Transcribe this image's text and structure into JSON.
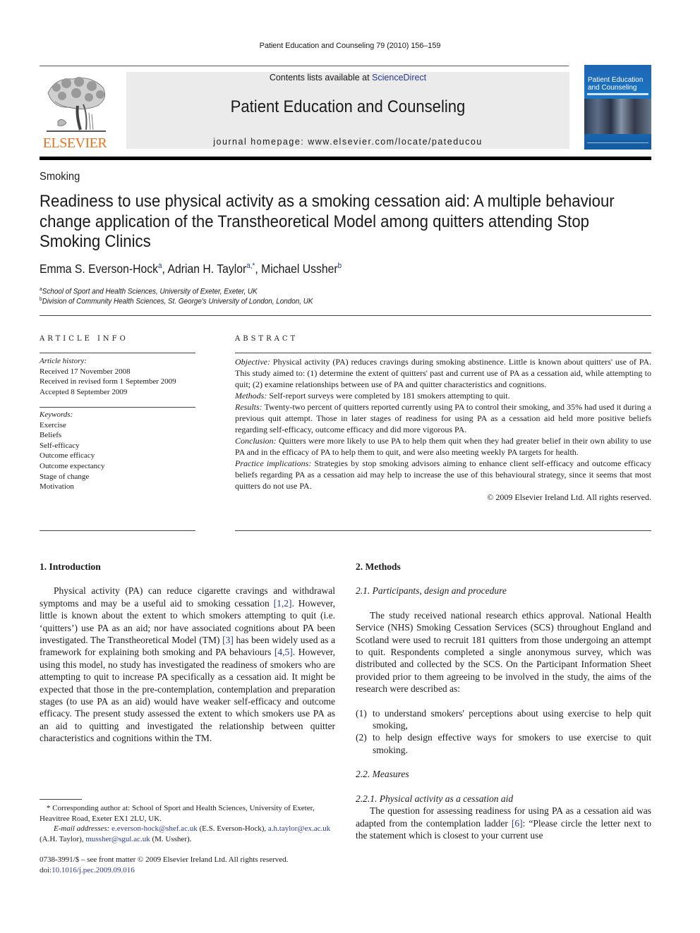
{
  "running_head": "Patient Education and Counseling 79 (2010) 156–159",
  "banner": {
    "contents_prefix": "Contents lists available at ",
    "contents_link": "ScienceDirect",
    "journal_title": "Patient Education and Counseling",
    "homepage": "journal homepage: www.elsevier.com/locate/pateducou"
  },
  "publisher_logo": {
    "wordmark": "ELSEVIER",
    "icon": "elsevier-tree-logo"
  },
  "cover": {
    "title_line1": "Patient Education",
    "title_line2": "and Counseling"
  },
  "section_label": "Smoking",
  "title": "Readiness to use physical activity as a smoking cessation aid: A multiple behaviour change application of the Transtheoretical Model among quitters attending Stop Smoking Clinics",
  "authors": [
    {
      "name": "Emma S. Everson-Hock",
      "sup": "a"
    },
    {
      "name": "Adrian H. Taylor",
      "sup": "a,*"
    },
    {
      "name": "Michael Ussher",
      "sup": "b"
    }
  ],
  "affiliations": [
    {
      "sup": "a",
      "text": "School of Sport and Health Sciences, University of Exeter, Exeter, UK"
    },
    {
      "sup": "b",
      "text": "Division of Community Health Sciences, St. George's University of London, London, UK"
    }
  ],
  "article_info": {
    "heading": "ARTICLE INFO",
    "history_label": "Article history:",
    "history": [
      "Received 17 November 2008",
      "Received in revised form 1 September 2009",
      "Accepted 8 September 2009"
    ],
    "keywords_label": "Keywords:",
    "keywords": [
      "Exercise",
      "Beliefs",
      "Self-efficacy",
      "Outcome efficacy",
      "Outcome expectancy",
      "Stage of change",
      "Motivation"
    ]
  },
  "abstract": {
    "heading": "ABSTRACT",
    "sections": [
      {
        "label": "Objective:",
        "text": " Physical activity (PA) reduces cravings during smoking abstinence. Little is known about quitters' use of PA. This study aimed to: (1) determine the extent of quitters' past and current use of PA as a cessation aid, while attempting to quit; (2) examine relationships between use of PA and quitter characteristics and cognitions."
      },
      {
        "label": "Methods:",
        "text": " Self-report surveys were completed by 181 smokers attempting to quit."
      },
      {
        "label": "Results:",
        "text": " Twenty-two percent of quitters reported currently using PA to control their smoking, and 35% had used it during a previous quit attempt. Those in later stages of readiness for using PA as a cessation aid held more positive beliefs regarding self-efficacy, outcome efficacy and did more vigorous PA."
      },
      {
        "label": "Conclusion:",
        "text": " Quitters were more likely to use PA to help them quit when they had greater belief in their own ability to use PA and in the efficacy of PA to help them to quit, and were also meeting weekly PA targets for health."
      },
      {
        "label": "Practice implications:",
        "text": " Strategies by stop smoking advisors aiming to enhance client self-efficacy and outcome efficacy beliefs regarding PA as a cessation aid may help to increase the use of this behavioural strategy, since it seems that most quitters do not use PA."
      }
    ],
    "copyright": "© 2009 Elsevier Ireland Ltd. All rights reserved."
  },
  "intro": {
    "heading": "1.  Introduction",
    "p1_a": "Physical activity (PA) can reduce cigarette cravings and withdrawal symptoms and may be a useful aid to smoking cessation ",
    "ref1": "[1,2]",
    "p1_b": ". However, little is known about the extent to which smokers attempting to quit (i.e. ‘quitters’) use PA as an aid; nor have associated cognitions about PA been investigated. The Transtheoretical Model (TM) ",
    "ref2": "[3]",
    "p1_c": " has been widely used as a framework for explaining both smoking and PA behaviours ",
    "ref3": "[4,5]",
    "p1_d": ". However, using this model, no study has investigated the readiness of smokers who are attempting to quit to increase PA specifically as a cessation aid. It might be expected that those in the pre-contemplation, contemplation and preparation stages (to use PA as an aid) would have weaker self-efficacy and outcome efficacy. The present study assessed the extent to which smokers use PA as an aid to quitting and investigated the relationship between quitter characteristics and cognitions within the TM."
  },
  "methods": {
    "heading": "2.  Methods",
    "sub1": "2.1.  Participants, design and procedure",
    "p1": "The study received national research ethics approval. National Health Service (NHS) Smoking Cessation Services (SCS) throughout England and Scotland were used to recruit 181 quitters from those undergoing an attempt to quit. Respondents completed a single anonymous survey, which was distributed and collected by the SCS. On the Participant Information Sheet provided prior to them agreeing to be involved in the study, the aims of the research were described as:",
    "list": [
      {
        "num": "(1)",
        "text": "to understand smokers' perceptions about using exercise to help quit smoking,"
      },
      {
        "num": "(2)",
        "text": "to help design effective ways for smokers to use exercise to quit smoking."
      }
    ],
    "sub2": "2.2.  Measures",
    "sub3": "2.2.1.  Physical activity as a cessation aid",
    "p2_a": "The question for assessing readiness for using PA as a cessation aid was adapted from the contemplation ladder ",
    "ref": "[6]",
    "p2_b": ": “Please circle the letter next to the statement which is closest to your current use"
  },
  "footnotes": {
    "corresponding": "* Corresponding author at: School of Sport and Health Sciences, University of Exeter, Heavitree Road, Exeter EX1 2LU, UK.",
    "email_label": "E-mail addresses:",
    "emails": [
      {
        "address": "e.everson-hock@shef.ac.uk",
        "who": " (E.S. Everson-Hock),"
      },
      {
        "address": "a.h.taylor@ex.ac.uk",
        "who": " (A.H. Taylor), "
      },
      {
        "address": "mussher@sgul.ac.uk",
        "who": " (M. Ussher)."
      }
    ],
    "issn": "0738-3991/$ – see front matter © 2009 Elsevier Ireland Ltd. All rights reserved.",
    "doi_prefix": "doi:",
    "doi": "10.1016/j.pec.2009.09.016"
  }
}
